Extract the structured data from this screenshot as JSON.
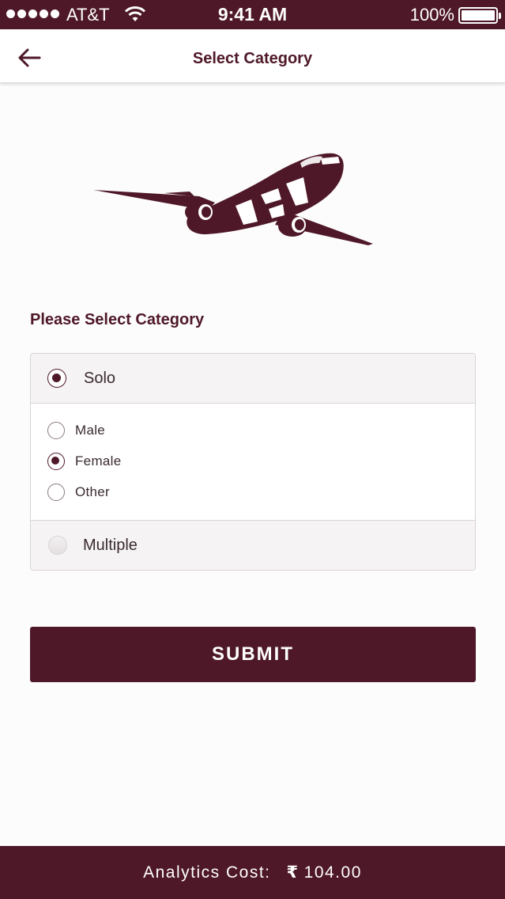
{
  "status_bar": {
    "carrier": "AT&T",
    "time": "9:41 AM",
    "battery": "100%"
  },
  "header": {
    "title": "Select Category"
  },
  "form": {
    "prompt": "Please Select Category",
    "categories": [
      {
        "label": "Solo",
        "selected": true
      },
      {
        "label": "Multiple",
        "selected": false
      }
    ],
    "sub_options": [
      {
        "label": "Male",
        "selected": false
      },
      {
        "label": "Female",
        "selected": true
      },
      {
        "label": "Other",
        "selected": false
      }
    ],
    "submit_label": "SUBMIT"
  },
  "footer": {
    "cost_label": "Analytics Cost:",
    "currency_symbol": "₹",
    "cost_value": "104.00"
  },
  "colors": {
    "brand": "#4e1828",
    "background": "#fdfcfc",
    "option_bg": "#f5f3f4"
  }
}
